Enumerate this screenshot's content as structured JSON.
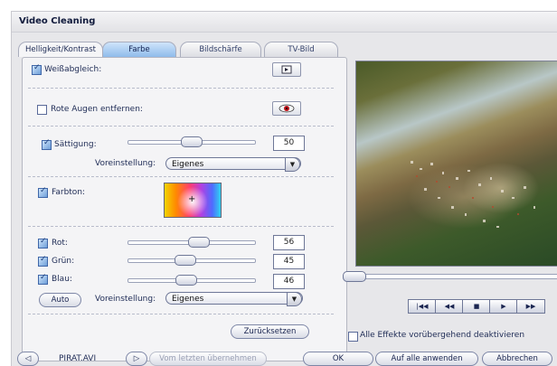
{
  "window": {
    "title": "Video Cleaning"
  },
  "tabs": [
    {
      "label": "Helligkeit/Kontrast"
    },
    {
      "label": "Farbe"
    },
    {
      "label": "Bildschärfe"
    },
    {
      "label": "TV-Bild"
    }
  ],
  "active_tab": "Farbe",
  "whitebalance": {
    "label": "Weißabgleich:",
    "checked": true
  },
  "redeye": {
    "label": "Rote Augen entfernen:",
    "checked": false
  },
  "saturation": {
    "label": "Sättigung:",
    "value": "50",
    "slider_fraction": 0.5,
    "checked": true
  },
  "preset1": {
    "label": "Voreinstellung:",
    "value": "Eigenes"
  },
  "hue": {
    "label": "Farbton:",
    "checked": true
  },
  "rgb": {
    "red": {
      "label": "Rot:",
      "value": "56",
      "slider_fraction": 0.56
    },
    "green": {
      "label": "Grün:",
      "value": "45",
      "slider_fraction": 0.45
    },
    "blue": {
      "label": "Blau:",
      "value": "46",
      "slider_fraction": 0.46
    }
  },
  "auto_label": "Auto",
  "preset2": {
    "label": "Voreinstellung:",
    "value": "Eigenes"
  },
  "reset_label": "Zurücksetzen",
  "disable_effects": {
    "label": "Alle Effekte vorübergehend deaktivieren",
    "checked": false
  },
  "transport": [
    "first-frame-icon",
    "rewind-icon",
    "stop-icon",
    "play-icon",
    "forward-icon"
  ],
  "footer": {
    "filename": "PIRAT.AVI",
    "copy_prev_label": "Vom letzten übernehmen",
    "ok_label": "OK",
    "apply_all_label": "Auf alle anwenden",
    "cancel_label": "Abbrechen"
  }
}
